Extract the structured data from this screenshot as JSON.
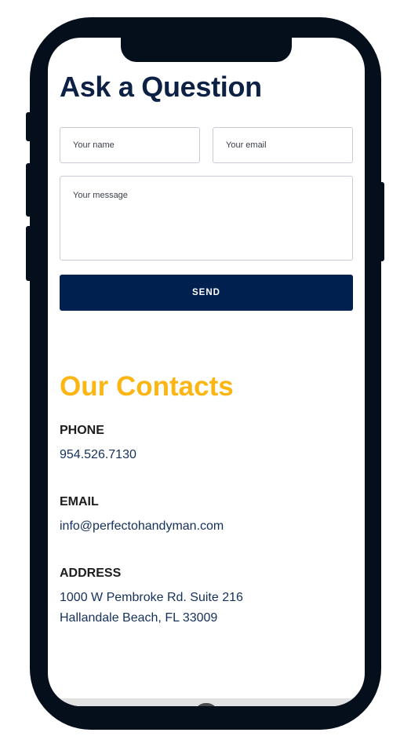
{
  "form": {
    "title": "Ask a Question",
    "name_placeholder": "Your name",
    "email_placeholder": "Your email",
    "message_placeholder": "Your message",
    "send_label": "SEND"
  },
  "contacts": {
    "title": "Our Contacts",
    "phone_label": "PHONE",
    "phone_value": "954.526.7130",
    "email_label": "EMAIL",
    "email_value": "info@perfectohandyman.com",
    "address_label": "ADDRESS",
    "address_line1": "1000 W Pembroke Rd. Suite 216",
    "address_line2": "Hallandale Beach, FL 33009"
  },
  "colors": {
    "heading_navy": "#0d2145",
    "button_navy": "#002150",
    "accent_yellow": "#fbb614",
    "phone_frame": "#050f1c"
  }
}
